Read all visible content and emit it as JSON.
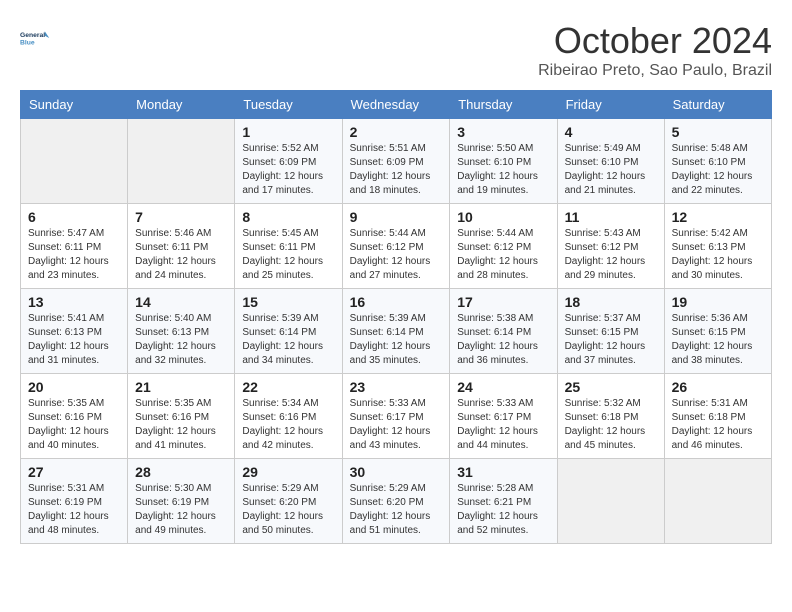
{
  "header": {
    "logo_line1": "General",
    "logo_line2": "Blue",
    "month": "October 2024",
    "location": "Ribeirao Preto, Sao Paulo, Brazil"
  },
  "days_of_week": [
    "Sunday",
    "Monday",
    "Tuesday",
    "Wednesday",
    "Thursday",
    "Friday",
    "Saturday"
  ],
  "weeks": [
    [
      {
        "day": "",
        "info": ""
      },
      {
        "day": "",
        "info": ""
      },
      {
        "day": "1",
        "info": "Sunrise: 5:52 AM\nSunset: 6:09 PM\nDaylight: 12 hours and 17 minutes."
      },
      {
        "day": "2",
        "info": "Sunrise: 5:51 AM\nSunset: 6:09 PM\nDaylight: 12 hours and 18 minutes."
      },
      {
        "day": "3",
        "info": "Sunrise: 5:50 AM\nSunset: 6:10 PM\nDaylight: 12 hours and 19 minutes."
      },
      {
        "day": "4",
        "info": "Sunrise: 5:49 AM\nSunset: 6:10 PM\nDaylight: 12 hours and 21 minutes."
      },
      {
        "day": "5",
        "info": "Sunrise: 5:48 AM\nSunset: 6:10 PM\nDaylight: 12 hours and 22 minutes."
      }
    ],
    [
      {
        "day": "6",
        "info": "Sunrise: 5:47 AM\nSunset: 6:11 PM\nDaylight: 12 hours and 23 minutes."
      },
      {
        "day": "7",
        "info": "Sunrise: 5:46 AM\nSunset: 6:11 PM\nDaylight: 12 hours and 24 minutes."
      },
      {
        "day": "8",
        "info": "Sunrise: 5:45 AM\nSunset: 6:11 PM\nDaylight: 12 hours and 25 minutes."
      },
      {
        "day": "9",
        "info": "Sunrise: 5:44 AM\nSunset: 6:12 PM\nDaylight: 12 hours and 27 minutes."
      },
      {
        "day": "10",
        "info": "Sunrise: 5:44 AM\nSunset: 6:12 PM\nDaylight: 12 hours and 28 minutes."
      },
      {
        "day": "11",
        "info": "Sunrise: 5:43 AM\nSunset: 6:12 PM\nDaylight: 12 hours and 29 minutes."
      },
      {
        "day": "12",
        "info": "Sunrise: 5:42 AM\nSunset: 6:13 PM\nDaylight: 12 hours and 30 minutes."
      }
    ],
    [
      {
        "day": "13",
        "info": "Sunrise: 5:41 AM\nSunset: 6:13 PM\nDaylight: 12 hours and 31 minutes."
      },
      {
        "day": "14",
        "info": "Sunrise: 5:40 AM\nSunset: 6:13 PM\nDaylight: 12 hours and 32 minutes."
      },
      {
        "day": "15",
        "info": "Sunrise: 5:39 AM\nSunset: 6:14 PM\nDaylight: 12 hours and 34 minutes."
      },
      {
        "day": "16",
        "info": "Sunrise: 5:39 AM\nSunset: 6:14 PM\nDaylight: 12 hours and 35 minutes."
      },
      {
        "day": "17",
        "info": "Sunrise: 5:38 AM\nSunset: 6:14 PM\nDaylight: 12 hours and 36 minutes."
      },
      {
        "day": "18",
        "info": "Sunrise: 5:37 AM\nSunset: 6:15 PM\nDaylight: 12 hours and 37 minutes."
      },
      {
        "day": "19",
        "info": "Sunrise: 5:36 AM\nSunset: 6:15 PM\nDaylight: 12 hours and 38 minutes."
      }
    ],
    [
      {
        "day": "20",
        "info": "Sunrise: 5:35 AM\nSunset: 6:16 PM\nDaylight: 12 hours and 40 minutes."
      },
      {
        "day": "21",
        "info": "Sunrise: 5:35 AM\nSunset: 6:16 PM\nDaylight: 12 hours and 41 minutes."
      },
      {
        "day": "22",
        "info": "Sunrise: 5:34 AM\nSunset: 6:16 PM\nDaylight: 12 hours and 42 minutes."
      },
      {
        "day": "23",
        "info": "Sunrise: 5:33 AM\nSunset: 6:17 PM\nDaylight: 12 hours and 43 minutes."
      },
      {
        "day": "24",
        "info": "Sunrise: 5:33 AM\nSunset: 6:17 PM\nDaylight: 12 hours and 44 minutes."
      },
      {
        "day": "25",
        "info": "Sunrise: 5:32 AM\nSunset: 6:18 PM\nDaylight: 12 hours and 45 minutes."
      },
      {
        "day": "26",
        "info": "Sunrise: 5:31 AM\nSunset: 6:18 PM\nDaylight: 12 hours and 46 minutes."
      }
    ],
    [
      {
        "day": "27",
        "info": "Sunrise: 5:31 AM\nSunset: 6:19 PM\nDaylight: 12 hours and 48 minutes."
      },
      {
        "day": "28",
        "info": "Sunrise: 5:30 AM\nSunset: 6:19 PM\nDaylight: 12 hours and 49 minutes."
      },
      {
        "day": "29",
        "info": "Sunrise: 5:29 AM\nSunset: 6:20 PM\nDaylight: 12 hours and 50 minutes."
      },
      {
        "day": "30",
        "info": "Sunrise: 5:29 AM\nSunset: 6:20 PM\nDaylight: 12 hours and 51 minutes."
      },
      {
        "day": "31",
        "info": "Sunrise: 5:28 AM\nSunset: 6:21 PM\nDaylight: 12 hours and 52 minutes."
      },
      {
        "day": "",
        "info": ""
      },
      {
        "day": "",
        "info": ""
      }
    ]
  ]
}
